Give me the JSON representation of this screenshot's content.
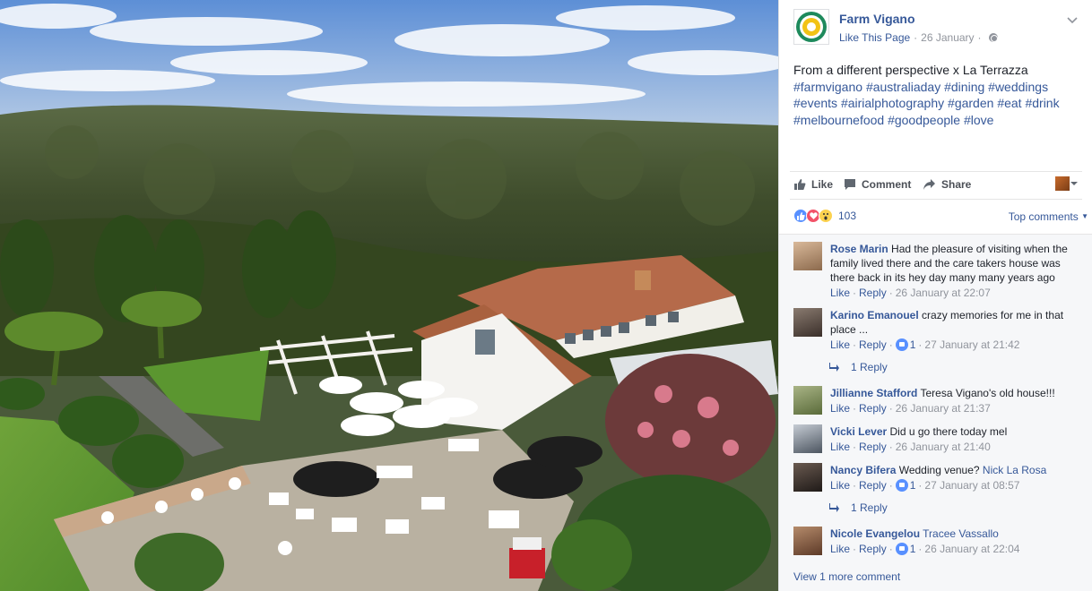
{
  "post": {
    "page_name": "Farm Vigano",
    "like_page": "Like This Page",
    "separator": "·",
    "date": "26 January",
    "privacy_icon": "globe-icon",
    "text_line": "From a different perspective x La Terrazza",
    "hashtags": [
      "#farmvigano",
      "#australiaday",
      "#dining",
      "#weddings",
      "#events",
      "#airialphotography",
      "#garden",
      "#eat",
      "#drink",
      "#melbournefood",
      "#goodpeople",
      "#love"
    ]
  },
  "actions": {
    "like": "Like",
    "comment": "Comment",
    "share": "Share"
  },
  "reactions": {
    "count": "103",
    "types": [
      "like-icon",
      "love-icon",
      "wow-icon"
    ],
    "sort_label": "Top comments"
  },
  "comments": [
    {
      "name": "Rose Marin",
      "text": "Had the pleasure of visiting when the family lived there and the care takers house was there back in its hey day many many years ago",
      "like": "Like",
      "reply": "Reply",
      "time": "26 January at 22:07"
    },
    {
      "name": "Karino Emanouel",
      "text": "crazy memories for me in that place ...",
      "like": "Like",
      "reply": "Reply",
      "likes": "1",
      "time": "27 January at 21:42",
      "replies_label": "1 Reply"
    },
    {
      "name": "Jillianne Stafford",
      "text": "Teresa Vigano's old house!!!",
      "like": "Like",
      "reply": "Reply",
      "time": "26 January at 21:37"
    },
    {
      "name": "Vicki Lever",
      "text": "Did u go there today mel",
      "like": "Like",
      "reply": "Reply",
      "time": "26 January at 21:40"
    },
    {
      "name": "Nancy Bifera",
      "text": "Wedding venue?",
      "tag": "Nick La Rosa",
      "like": "Like",
      "reply": "Reply",
      "likes": "1",
      "time": "27 January at 08:57",
      "replies_label": "1 Reply"
    },
    {
      "name": "Nicole Evangelou",
      "text": "",
      "tag": "Tracee Vassallo",
      "like": "Like",
      "reply": "Reply",
      "likes": "1",
      "time": "26 January at 22:04"
    }
  ],
  "view_more": "View 1 more comment",
  "colors": {
    "link": "#365899",
    "meta": "#90949c",
    "comments_bg": "#f6f7f9"
  }
}
